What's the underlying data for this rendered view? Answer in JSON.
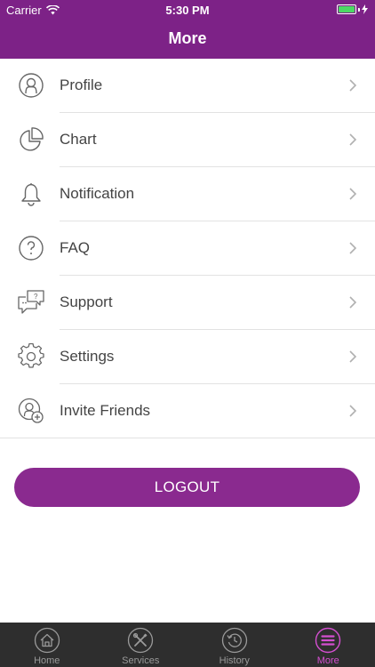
{
  "status_bar": {
    "carrier": "Carrier",
    "time": "5:30 PM"
  },
  "nav": {
    "title": "More"
  },
  "menu": {
    "items": [
      {
        "label": "Profile",
        "icon": "profile-icon"
      },
      {
        "label": "Chart",
        "icon": "pie-chart-icon"
      },
      {
        "label": "Notification",
        "icon": "bell-icon"
      },
      {
        "label": "FAQ",
        "icon": "question-icon"
      },
      {
        "label": "Support",
        "icon": "chat-bubbles-icon"
      },
      {
        "label": "Settings",
        "icon": "gear-icon"
      },
      {
        "label": "Invite Friends",
        "icon": "add-friend-icon"
      }
    ]
  },
  "logout_label": "LOGOUT",
  "tabbar": {
    "tabs": [
      {
        "label": "Home",
        "icon": "home-icon"
      },
      {
        "label": "Services",
        "icon": "tools-icon"
      },
      {
        "label": "History",
        "icon": "history-icon"
      },
      {
        "label": "More",
        "icon": "menu-icon",
        "active": true
      }
    ]
  },
  "colors": {
    "header": "#7d2287",
    "logout_button": "#8a2a8f",
    "tab_active": "#d44fd0",
    "tabbar_bg": "#2e2e2e"
  }
}
